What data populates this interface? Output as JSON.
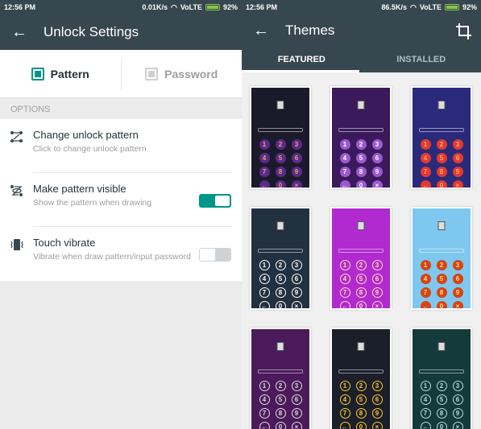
{
  "left": {
    "status": {
      "time": "12:56 PM",
      "speed": "0.01K/s",
      "network": "VoLTE",
      "battery": "92%"
    },
    "appbar": {
      "back_icon": "arrow-back-icon",
      "title": "Unlock Settings"
    },
    "segments": [
      {
        "label": "Pattern",
        "selected": true
      },
      {
        "label": "Password",
        "selected": false
      }
    ],
    "section_header": "OPTIONS",
    "items": [
      {
        "icon": "pattern-dots-icon",
        "title": "Change unlock pattern",
        "subtitle": "Click to change unlock pattern"
      },
      {
        "icon": "pattern-visible-icon",
        "title": "Make pattern visible",
        "subtitle": "Show the pattern when drawing",
        "toggle": true
      },
      {
        "icon": "vibrate-icon",
        "title": "Touch vibrate",
        "subtitle": "Vibrate when draw pattern/input password",
        "toggle": false
      }
    ]
  },
  "right": {
    "status": {
      "time": "12:56 PM",
      "speed": "86.5K/s",
      "network": "VoLTE",
      "battery": "92%"
    },
    "appbar": {
      "back_icon": "arrow-back-icon",
      "title": "Themes",
      "action_icon": "crop-icon"
    },
    "tabs": [
      {
        "label": "FEATURED",
        "active": true
      },
      {
        "label": "INSTALLED",
        "active": false
      }
    ],
    "themes": [
      {
        "name": "neon-ring",
        "bg": "#1b1a2a",
        "key_bg": "#5b2a8a",
        "key_fg": "#f0a060"
      },
      {
        "name": "cave-purple",
        "bg": "#3a1a5a",
        "key_bg": "#9b59d0",
        "key_fg": "#fff"
      },
      {
        "name": "red-dragon",
        "bg": "#2a2a7a",
        "key_bg": "#e53935",
        "key_fg": "#ffb74d"
      },
      {
        "name": "dark-birds",
        "bg": "#22313f",
        "key_bg": "transparent",
        "key_fg": "#fff"
      },
      {
        "name": "retro-magenta",
        "bg": "#b02ad0",
        "key_bg": "transparent",
        "key_fg": "#ffe0b2"
      },
      {
        "name": "pixel-sky",
        "bg": "#7ec8f0",
        "key_bg": "#d84315",
        "key_fg": "#ffe082"
      },
      {
        "name": "aurora-pink",
        "bg": "#4a1a5a",
        "key_bg": "transparent",
        "key_fg": "#ddd"
      },
      {
        "name": "neon-city",
        "bg": "#1a1f2a",
        "key_bg": "transparent",
        "key_fg": "#ffca28"
      },
      {
        "name": "teal-galaxy",
        "bg": "#143a3a",
        "key_bg": "transparent",
        "key_fg": "#b2dfdb"
      }
    ],
    "keypad": [
      "1",
      "2",
      "3",
      "4",
      "5",
      "6",
      "7",
      "8",
      "9",
      "←",
      "0",
      "×"
    ]
  }
}
